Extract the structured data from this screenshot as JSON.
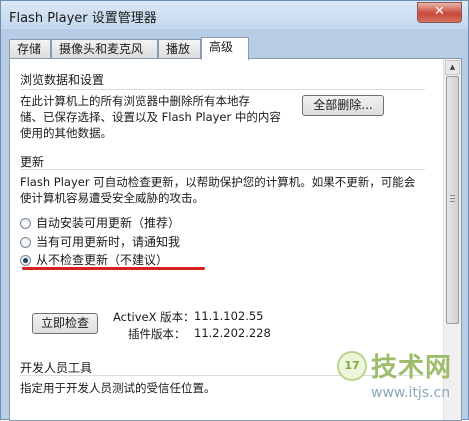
{
  "window": {
    "title": "Flash Player 设置管理器",
    "close_symbol": "✕"
  },
  "tabs": [
    {
      "label": "存储",
      "active": false
    },
    {
      "label": "摄像头和麦克风",
      "active": false
    },
    {
      "label": "播放",
      "active": false
    },
    {
      "label": "高级",
      "active": true
    }
  ],
  "browsing": {
    "title": "浏览数据和设置",
    "desc_line1": "在此计算机上的所有浏览器中删除所有本地存",
    "desc_line2": "储、已保存选择、设置以及 Flash Player 中的内容",
    "desc_line3": "使用的其他数据。",
    "delete_all_button": "全部删除..."
  },
  "updates": {
    "title": "更新",
    "desc_line1": "Flash Player 可自动检查更新，以帮助保护您的计算机。如果不更新，可能会",
    "desc_line2": "使计算机容易遭受安全威胁的攻击。",
    "options": [
      {
        "label": "自动安装可用更新（推荐）",
        "checked": false
      },
      {
        "label": "当有可用更新时，请通知我",
        "checked": false
      },
      {
        "label": "从不检查更新（不建议）",
        "checked": true
      }
    ],
    "check_now_button": "立即检查",
    "activex_label": "ActiveX 版本：",
    "activex_version": "11.1.102.55",
    "plugin_label": "插件版本：",
    "plugin_version": "11.2.202.228"
  },
  "developer": {
    "title": "开发人员工具",
    "desc": "指定用于开发人员测试的受信任位置。"
  },
  "watermark": {
    "badge": "17",
    "text": "技术网",
    "url": "www.itjs.cn"
  },
  "colors": {
    "annotation_underline": "#d62020"
  }
}
